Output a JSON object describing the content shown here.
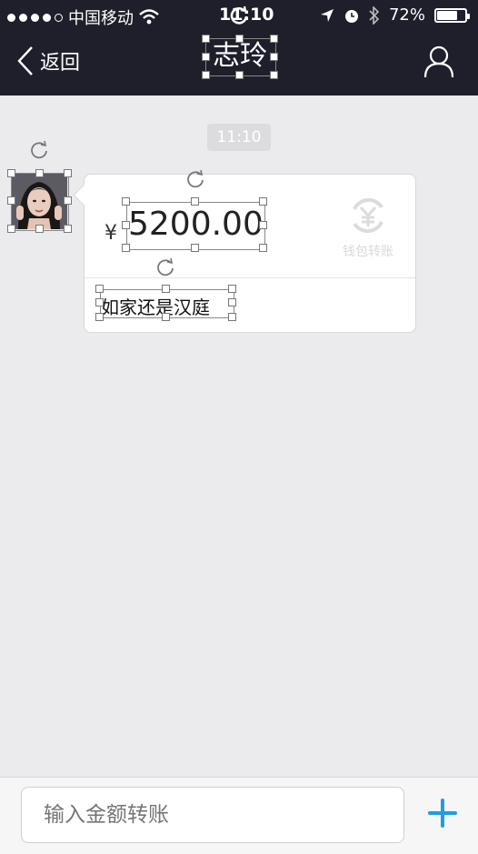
{
  "status_bar": {
    "carrier": "中国移动",
    "time": "11:10",
    "battery": "72%",
    "battery_level": 0.72,
    "icons": [
      "signal-dots",
      "wifi-icon",
      "location-icon",
      "alarm-icon",
      "bluetooth-icon",
      "battery-icon"
    ]
  },
  "nav": {
    "back_label": "返回",
    "title": "志玲",
    "profile_icon": "person-icon"
  },
  "chat": {
    "timestamp": "11:10",
    "transfer": {
      "currency_symbol": "¥",
      "amount": "5200.00",
      "badge_label": "钱包转账",
      "message": "如家还是汉庭"
    }
  },
  "composer": {
    "placeholder": "输入金额转账",
    "add_icon": "plus-icon"
  },
  "colors": {
    "header_bg": "#1f1f2b",
    "chat_bg": "#ebebee",
    "accent_plus": "#1e9fe0"
  }
}
